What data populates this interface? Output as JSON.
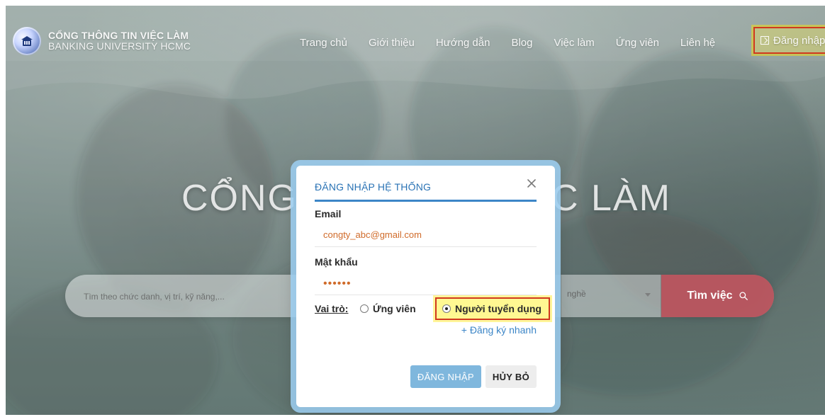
{
  "brand": {
    "title": "CỔNG THÔNG TIN VIỆC LÀM",
    "subtitle": "BANKING UNIVERSITY HCMC"
  },
  "nav": {
    "items": [
      {
        "label": "Trang chủ"
      },
      {
        "label": "Giới thiệu"
      },
      {
        "label": "Hướng dẫn"
      },
      {
        "label": "Blog"
      },
      {
        "label": "Việc làm"
      },
      {
        "label": "Ứng viên"
      },
      {
        "label": "Liên hệ"
      }
    ],
    "login_label": "Đăng nhập"
  },
  "hero": {
    "left_text": "CỔNG",
    "right_text": "C LÀM"
  },
  "search": {
    "placeholder": "Tìm theo chức danh, vị trí, kỹ năng,...",
    "industry_value": "nghề",
    "button_label": "Tìm việc"
  },
  "modal": {
    "title": "ĐĂNG NHẬP HỆ THỐNG",
    "email_label": "Email",
    "email_value": "congty_abc@gmail.com",
    "password_label": "Mật khẩu",
    "password_value": "••••••",
    "role_label": "Vai trò:",
    "role_options": [
      {
        "label": "Ứng viên",
        "selected": false
      },
      {
        "label": "Người tuyển dụng",
        "selected": true
      }
    ],
    "quick_register_label": "+ Đăng ký nhanh",
    "login_button_label": "ĐĂNG NHẬP",
    "cancel_button_label": "HỦY BỎ"
  },
  "colors": {
    "accent_blue": "#3c86c7",
    "primary_button": "#7fb7dd",
    "highlight_border": "#d0381f",
    "highlight_fill": "#fff56e",
    "search_button": "#be505a",
    "email_text": "#d06b2a"
  }
}
